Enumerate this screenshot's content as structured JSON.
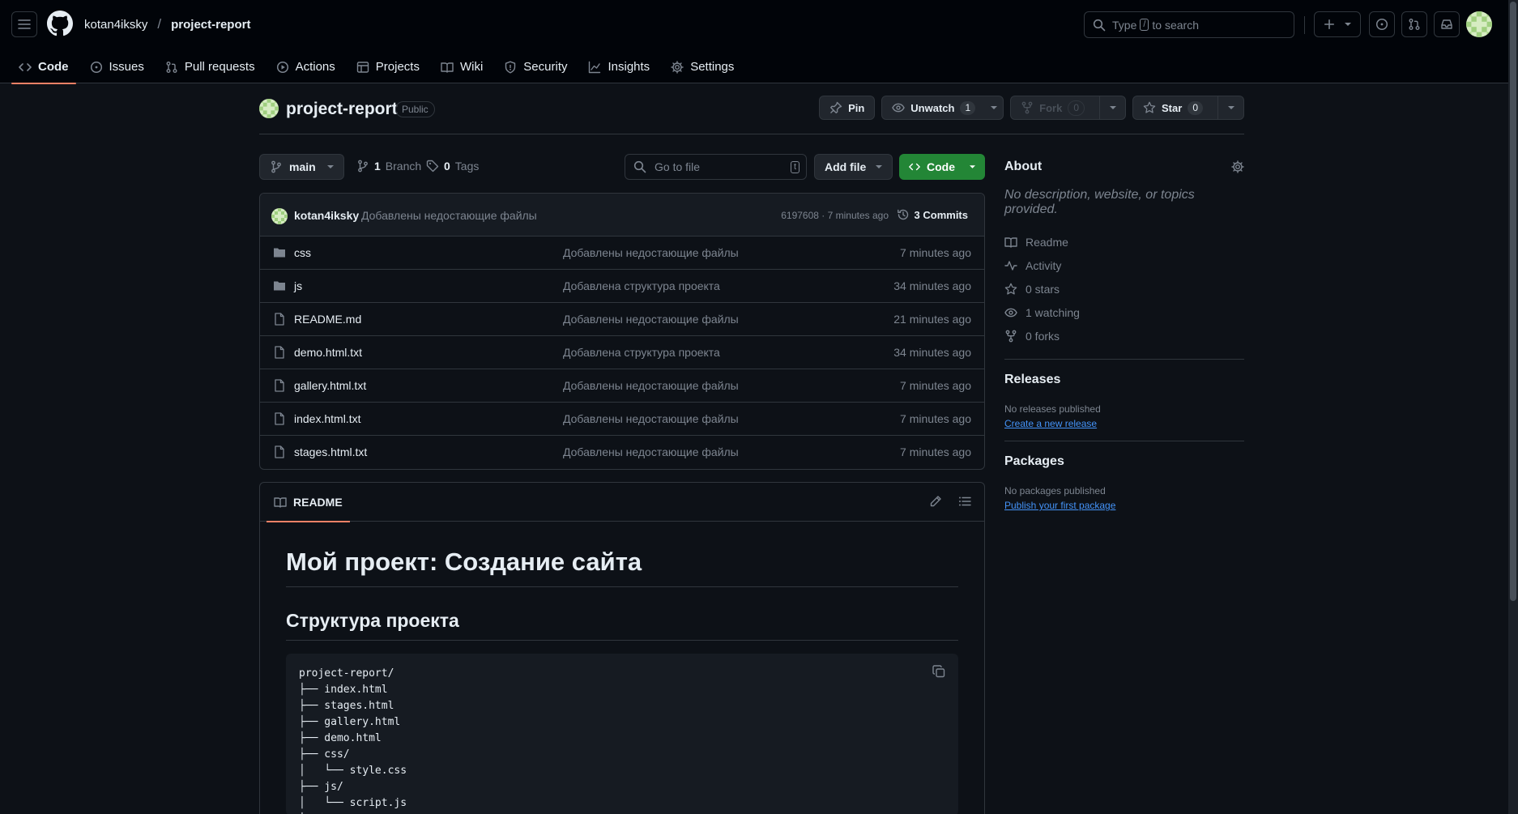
{
  "header": {
    "owner": "kotan4iksky",
    "separator": "/",
    "repo": "project-report",
    "search_prefix": "Type",
    "search_key": "/",
    "search_suffix": "to search"
  },
  "tabs": [
    {
      "label": "Code",
      "icon": "code-icon"
    },
    {
      "label": "Issues",
      "icon": "issue-icon"
    },
    {
      "label": "Pull requests",
      "icon": "pull-request-icon"
    },
    {
      "label": "Actions",
      "icon": "play-icon"
    },
    {
      "label": "Projects",
      "icon": "table-icon"
    },
    {
      "label": "Wiki",
      "icon": "book-icon"
    },
    {
      "label": "Security",
      "icon": "shield-icon"
    },
    {
      "label": "Insights",
      "icon": "graph-icon"
    },
    {
      "label": "Settings",
      "icon": "gear-icon"
    }
  ],
  "repo_head": {
    "name": "project-report",
    "visibility": "Public",
    "pin_label": "Pin",
    "unwatch_label": "Unwatch",
    "watch_count": "1",
    "fork_label": "Fork",
    "fork_count": "0",
    "star_label": "Star",
    "star_count": "0"
  },
  "filenav": {
    "branch": "main",
    "branch_count": "1",
    "branch_label": "Branch",
    "tag_count": "0",
    "tag_label": "Tags",
    "goto_placeholder": "Go to file",
    "goto_key": "t",
    "add_file_label": "Add file",
    "code_label": "Code"
  },
  "commit": {
    "user": "kotan4iksky",
    "message": "Добавлены недостающие файлы",
    "hash_time": "6197608 · 7 minutes ago",
    "commits_label": "3 Commits"
  },
  "files": [
    {
      "type": "dir",
      "name": "css",
      "message": "Добавлены недостающие файлы",
      "time": "7 minutes ago"
    },
    {
      "type": "dir",
      "name": "js",
      "message": "Добавлена структура проекта",
      "time": "34 minutes ago"
    },
    {
      "type": "file",
      "name": "README.md",
      "message": "Добавлены недостающие файлы",
      "time": "21 minutes ago"
    },
    {
      "type": "file",
      "name": "demo.html.txt",
      "message": "Добавлена структура проекта",
      "time": "34 minutes ago"
    },
    {
      "type": "file",
      "name": "gallery.html.txt",
      "message": "Добавлены недостающие файлы",
      "time": "7 minutes ago"
    },
    {
      "type": "file",
      "name": "index.html.txt",
      "message": "Добавлены недостающие файлы",
      "time": "7 minutes ago"
    },
    {
      "type": "file",
      "name": "stages.html.txt",
      "message": "Добавлены недостающие файлы",
      "time": "7 minutes ago"
    }
  ],
  "readme": {
    "tab_label": "README",
    "h1": "Мой проект: Создание сайта",
    "h2": "Структура проекта",
    "code": "project-report/\n├── index.html\n├── stages.html\n├── gallery.html\n├── demo.html\n├── css/\n│   └── style.css\n├── js/\n│   └── script.js\n│"
  },
  "sidebar": {
    "about_title": "About",
    "about_desc": "No description, website, or topics provided.",
    "items": [
      {
        "label": "Readme",
        "icon": "book-icon"
      },
      {
        "label": "Activity",
        "icon": "pulse-icon"
      },
      {
        "label": "0 stars",
        "icon": "star-icon"
      },
      {
        "label": "1 watching",
        "icon": "eye-icon"
      },
      {
        "label": "0 forks",
        "icon": "fork-icon"
      }
    ],
    "releases_title": "Releases",
    "releases_none": "No releases published",
    "releases_link": "Create a new release",
    "packages_title": "Packages",
    "packages_none": "No packages published",
    "packages_link": "Publish your first package"
  },
  "colors": {
    "accent_green": "#238636",
    "tab_underline": "#f78166",
    "link_blue": "#4493f8"
  }
}
